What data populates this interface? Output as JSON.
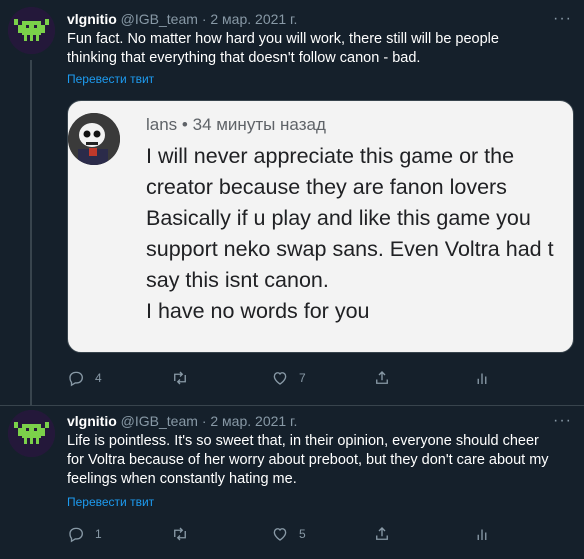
{
  "tweets": [
    {
      "name": "vlgnitio",
      "handle": "@IGB_team",
      "separator": "·",
      "date": "2 мар. 2021 г.",
      "more": "···",
      "text_lines": [
        "Fun fact. No matter how hard you will work, there still will be people",
        "thinking that everything that doesn't follow canon - bad."
      ],
      "translate": "Перевести твит",
      "quoted_image": {
        "name": "lans",
        "separator": "•",
        "time": "34 минуты назад",
        "lines": [
          "I will never appreciate this game or the",
          "creator because they are fanon lovers",
          "Basically if u play and like this game you",
          "support neko swap sans. Even Voltra had t",
          "say this isnt canon.",
          "I have no words for you"
        ]
      },
      "actions": {
        "replies": "4",
        "retweets": "",
        "likes": "7"
      }
    },
    {
      "name": "vlgnitio",
      "handle": "@IGB_team",
      "separator": "·",
      "date": "2 мар. 2021 г.",
      "more": "···",
      "text_lines": [
        "Life is pointless. It's so sweet that, in their opinion, everyone should cheer",
        "for Voltra because of her worry about preboot, but they don't care about my",
        "feelings when constantly hating me."
      ],
      "translate": "Перевести твит",
      "actions": {
        "replies": "1",
        "retweets": "",
        "likes": "5"
      }
    }
  ],
  "colors": {
    "background": "#15202b",
    "secondary_text": "#8899a6",
    "link": "#1d9bf0",
    "divider": "#38444d"
  }
}
